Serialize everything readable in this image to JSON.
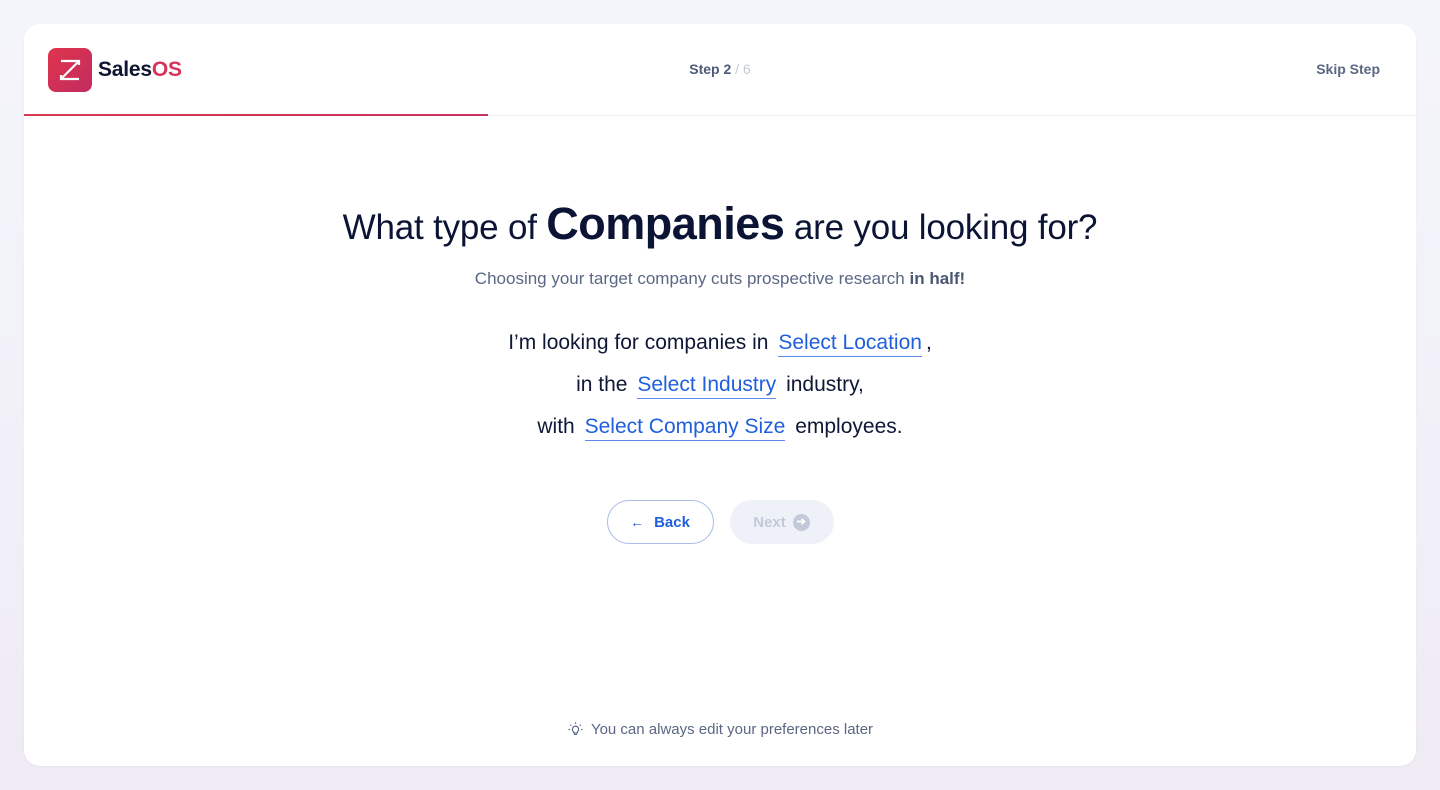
{
  "brand": {
    "name_prefix": "Sales",
    "name_suffix": "OS"
  },
  "header": {
    "step_label": "Step 2",
    "step_separator": "/",
    "step_total": "6",
    "skip_label": "Skip Step",
    "progress_fraction": 0.3333
  },
  "main": {
    "title_before": "What type of",
    "title_emphasis": "Companies",
    "title_after": "are you looking for?",
    "subtitle_text": "Choosing your target company cuts prospective research",
    "subtitle_emphasis": "in half!",
    "line1_prefix": "I’m looking for companies in",
    "location_select": "Select Location",
    "line1_suffix": ",",
    "line2_prefix": "in the",
    "industry_select": "Select Industry",
    "line2_suffix": "industry,",
    "line3_prefix": "with",
    "size_select": "Select Company Size",
    "line3_suffix": "employees."
  },
  "actions": {
    "back_label": "Back",
    "next_label": "Next"
  },
  "footer": {
    "hint": "You can always edit your preferences later"
  },
  "colors": {
    "brand_red": "#d8345a",
    "link_blue": "#1f5fdd",
    "text_dark": "#0b1435"
  }
}
